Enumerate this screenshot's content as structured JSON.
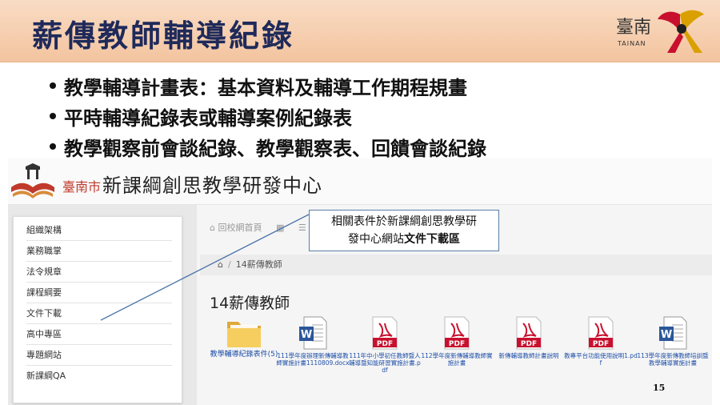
{
  "slide": {
    "title": "薪傳教師輔導紀錄",
    "logo": {
      "text": "臺南",
      "sub": "TAINAN"
    },
    "page_number": "15",
    "bullets": [
      "教學輔導計畫表：基本資料及輔導工作期程規畫",
      "平時輔導紀錄表或輔導案例紀錄表",
      "教學觀察前會談紀錄、教學觀察表、回饋會談紀錄"
    ]
  },
  "site": {
    "city": "臺南市",
    "title": "新課綱創思教學研發中心",
    "sidebar": [
      "組織架構",
      "業務職掌",
      "法令規章",
      "課程綱要",
      "文件下載",
      "高中專區",
      "專題網站",
      "新課綱QA"
    ],
    "topnav": [
      "回校網首頁",
      "",
      ""
    ],
    "breadcrumb": "14薪傳教師",
    "heading": "14薪傳教師",
    "files": [
      {
        "type": "folder",
        "label": "教學輔導紀錄表件(5)"
      },
      {
        "type": "word",
        "label": "111學年度辦理新傳輔導教師實施計畫1110809.docx"
      },
      {
        "type": "pdf",
        "label": "111年中小學初任教師暨人輔導暨知能研習實施計畫.pdf"
      },
      {
        "type": "pdf",
        "label": "112學年度新傳輔導教師實施計畫"
      },
      {
        "type": "pdf",
        "label": "新傳輔導教師計畫說明"
      },
      {
        "type": "pdf",
        "label": "教專平台功能使用說明1.pdf"
      },
      {
        "type": "word",
        "label": "113學年度新傳教師培訓暨教學輔導實施計畫"
      }
    ]
  },
  "callout": {
    "line1": "相關表件於新課綱創思教學研",
    "line2_prefix": "發中心網站",
    "line2_bold": "文件下載區"
  },
  "colors": {
    "title": "#1f2a5a",
    "header_band": "#f3c49f",
    "pdf": "#c8102e",
    "word": "#2b579a",
    "folder": "#f2c14e",
    "link": "#1f4fa8"
  },
  "icons": [
    "home-icon",
    "grid-icon",
    "list-icon",
    "folder-icon",
    "word-file-icon",
    "pdf-file-icon"
  ]
}
